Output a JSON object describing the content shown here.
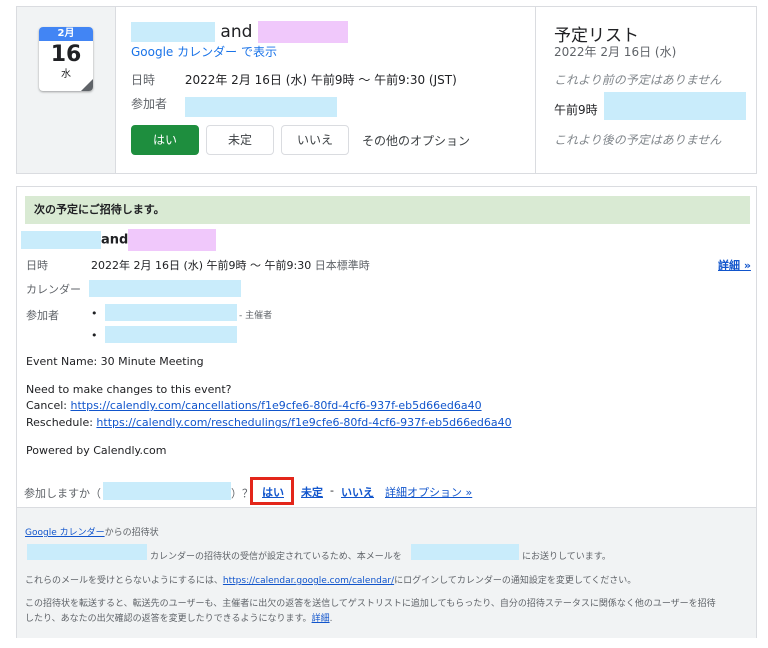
{
  "top_card": {
    "date_icon": {
      "month": "2月",
      "day": "16",
      "weekday": "水"
    },
    "title_and": "and",
    "gcal_link": "Google カレンダー で表示",
    "datetime_label": "日時",
    "datetime_value": "2022年 2月 16日 (水) 午前9時 〜 午前9:30 (JST)",
    "attendees_label": "参加者",
    "buttons": {
      "yes": "はい",
      "maybe": "未定",
      "no": "いいえ",
      "more": "その他のオプション"
    },
    "agenda": {
      "title": "予定リスト",
      "date": "2022年 2月 16日 (水)",
      "none_before": "これより前の予定はありません",
      "time": "午前9時",
      "none_after": "これより後の予定はありません"
    }
  },
  "invite": {
    "banner": "次の予定にご招待します。",
    "title_and": "and",
    "datetime_label": "日時",
    "datetime_value": "2022年 2月 16日 (水) 午前9時 〜 午前9:30",
    "timezone": "日本標準時",
    "details_link": "詳細 »",
    "calendar_label": "カレンダー",
    "attendees_label": "参加者",
    "organizer_suffix": "- 主催者",
    "bullet": "•",
    "event_name": "Event Name: 30 Minute Meeting",
    "changes_text": "Need to make changes to this event?",
    "cancel_label": "Cancel:",
    "cancel_url": "https://calendly.com/cancellations/f1e9cfe6-80fd-4cf6-937f-eb5d66ed6a40",
    "reschedule_label": "Reschedule:",
    "reschedule_url": "https://calendly.com/reschedulings/f1e9cfe6-80fd-4cf6-937f-eb5d66ed6a40",
    "powered_by": "Powered by Calendly.com",
    "rsvp": {
      "prompt": "参加しますか（",
      "close": "）？",
      "yes": "はい",
      "maybe": "未定",
      "sep": "-",
      "no": "いいえ",
      "more": "詳細オプション »"
    }
  },
  "footer": {
    "gcal_link": "Google カレンダー",
    "from_text": "からの招待状",
    "line2_mid": "カレンダーの招待状の受信が設定されているため、本メールを",
    "line2_end": "にお送りしています。",
    "line3_start": "これらのメールを受けとらないようにするには、",
    "line3_link": "https://calendar.google.com/calendar/",
    "line3_end": "にログインしてカレンダーの通知設定を変更してください。",
    "line4": "この招待状を転送すると、転送先のユーザーも、主催者に出欠の返答を送信してゲストリストに追加してもらったり、自分の招待ステータスに関係なく他のユーザーを招待",
    "line5": "したり、あなたの出欠確認の返答を変更したりできるようになります。",
    "line5_link": "詳細",
    "line5_end": "."
  },
  "colors": {
    "accent_green": "#1e8e3e",
    "link_blue": "#1155cc",
    "highlight_red": "#e3261a",
    "banner_green": "#d9ead3"
  }
}
